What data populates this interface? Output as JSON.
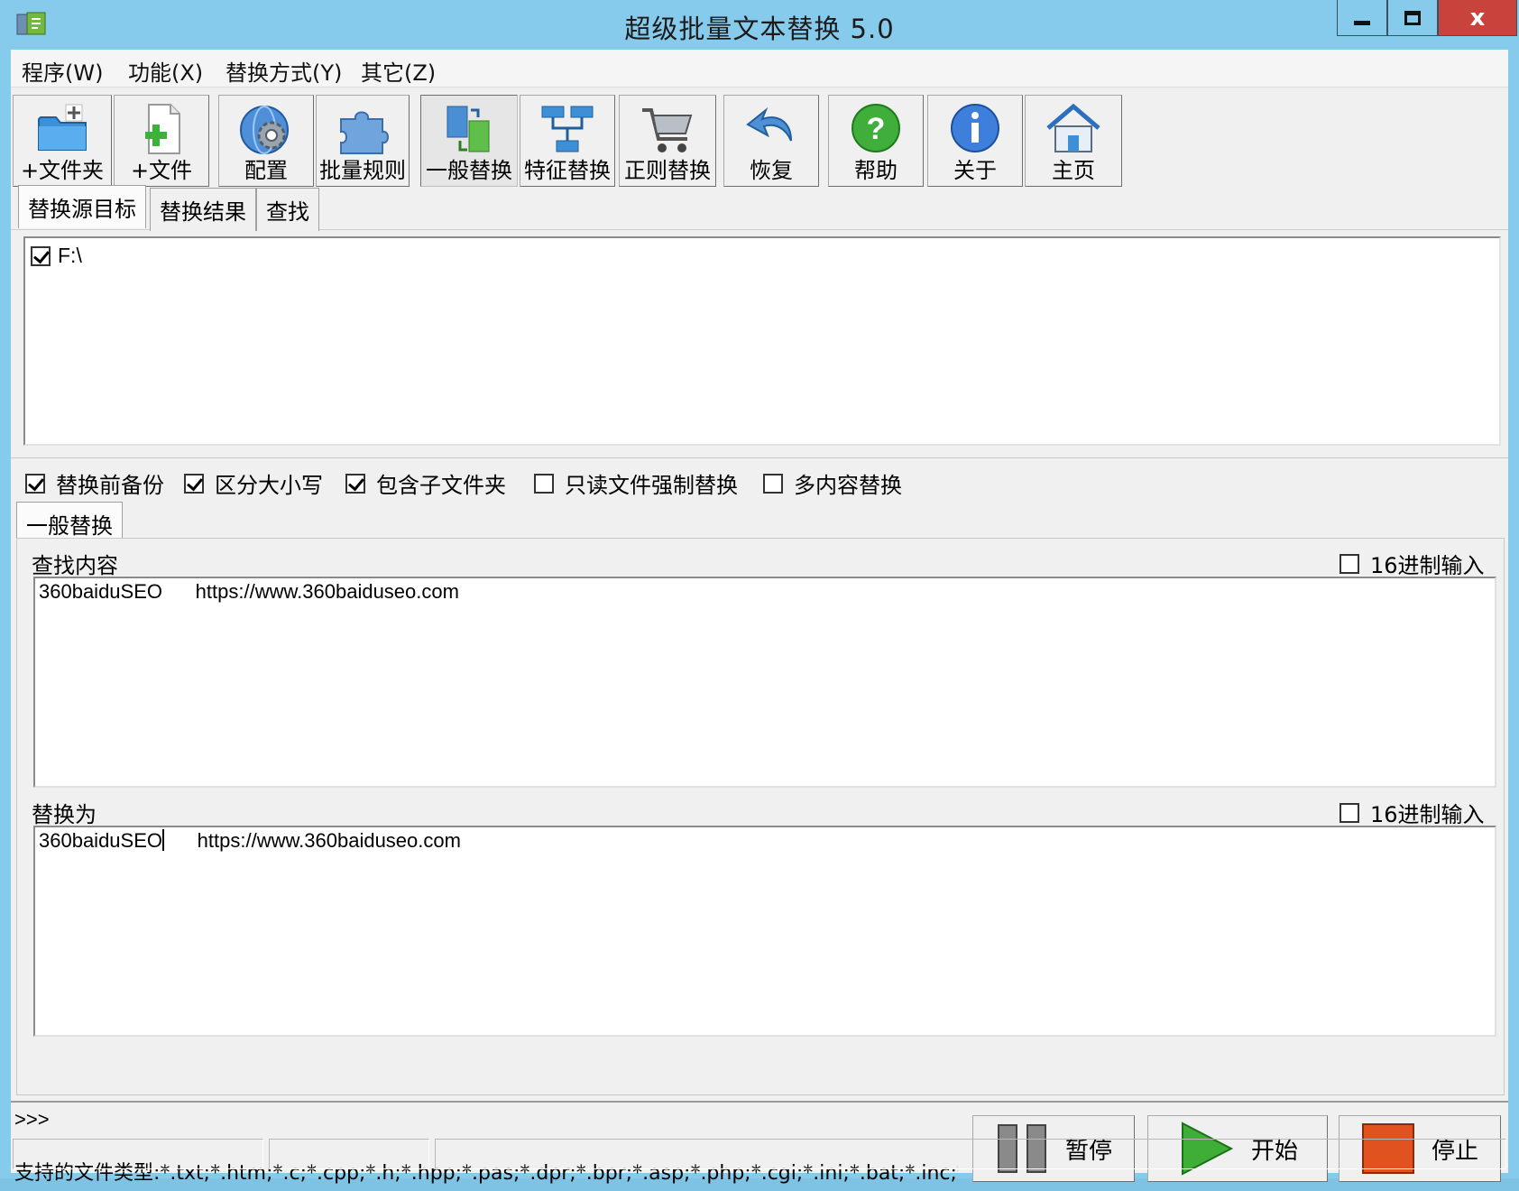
{
  "window": {
    "title": "超级批量文本替换 5.0",
    "close_glyph": "x"
  },
  "menu": [
    "程序(W)",
    "功能(X)",
    "替换方式(Y)",
    "其它(Z)"
  ],
  "toolbar": [
    {
      "label": "+文件夹",
      "icon": "folder-add-icon"
    },
    {
      "label": "+文件",
      "icon": "file-add-icon"
    },
    {
      "label": "配置",
      "icon": "gear-globe-icon"
    },
    {
      "label": "批量规则",
      "icon": "puzzle-icon"
    },
    {
      "label": "一般替换",
      "icon": "swap-docs-icon",
      "active": true
    },
    {
      "label": "特征替换",
      "icon": "network-icon"
    },
    {
      "label": "正则替换",
      "icon": "cart-icon"
    },
    {
      "label": "恢复",
      "icon": "undo-arrow-icon"
    },
    {
      "label": "帮助",
      "icon": "help-icon"
    },
    {
      "label": "关于",
      "icon": "info-icon"
    },
    {
      "label": "主页",
      "icon": "home-icon"
    }
  ],
  "source_tabs": [
    "替换源目标",
    "替换结果",
    "查找"
  ],
  "source_list": [
    {
      "path": "F:\\",
      "checked": true
    }
  ],
  "options": [
    {
      "label": "替换前备份",
      "checked": true
    },
    {
      "label": "区分大小写",
      "checked": true
    },
    {
      "label": "包含子文件夹",
      "checked": true
    },
    {
      "label": "只读文件强制替换",
      "checked": false
    },
    {
      "label": "多内容替换",
      "checked": false
    }
  ],
  "mode_tab": "一般替换",
  "find": {
    "label": "查找内容",
    "hex_label": "16进制输入",
    "hex_checked": false,
    "value": "360baiduSEO      https://www.360baiduseo.com"
  },
  "replace": {
    "label": "替换为",
    "hex_label": "16进制输入",
    "hex_checked": false,
    "value": "360baiduSEO      https://www.360baiduseo.com"
  },
  "log": {
    "prompt": ">>>",
    "file_types": "支持的文件类型:*.txt;*.htm;*.c;*.cpp;*.h;*.hpp;*.pas;*.dpr;*.bpr;*.asp;*.php;*.cgi;*.ini;*.bat;*.inc;*.java;*.py;*.dfm"
  },
  "actions": {
    "pause": "暂停",
    "start": "开始",
    "stop": "停止"
  },
  "colors": {
    "titlebar": "#87cbec",
    "close": "#c7433b",
    "start": "#3fae36",
    "stop": "#e0531f"
  }
}
